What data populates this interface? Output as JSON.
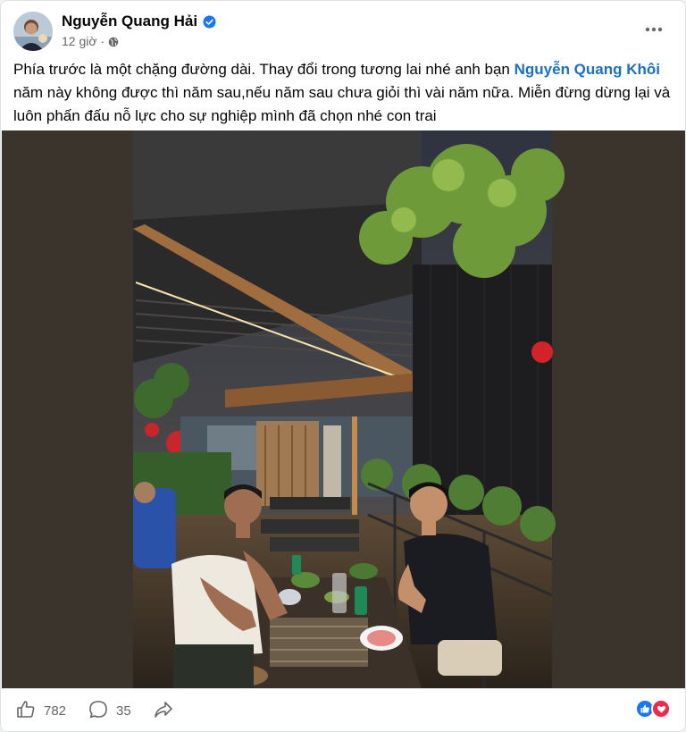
{
  "post": {
    "author": "Nguyễn Quang Hải",
    "time": "12 giờ",
    "separator": "·",
    "text_before": "Phía trước là một chặng đường dài. Thay đổi trong tương lai nhé anh bạn ",
    "mention": "Nguyễn Quang Khôi",
    "text_after": " năm này không được thì năm sau,nếu năm sau chưa giỏi thì vài năm nữa. Miễn đừng dừng lại và luôn phấn đấu nỗ lực cho sự nghiệp mình đã chọn nhé con trai"
  },
  "icons": {
    "verified": "verified-badge-icon",
    "privacy": "globe-icon",
    "more": "more-options-icon",
    "like": "thumbs-up-icon",
    "comment": "comment-icon",
    "share": "share-icon"
  },
  "stats": {
    "likes": "782",
    "comments": "35"
  },
  "colors": {
    "mention": "#1b6fc4",
    "verified": "#1877f2",
    "like_reaction": "#1877f2",
    "love_reaction": "#f02849"
  }
}
